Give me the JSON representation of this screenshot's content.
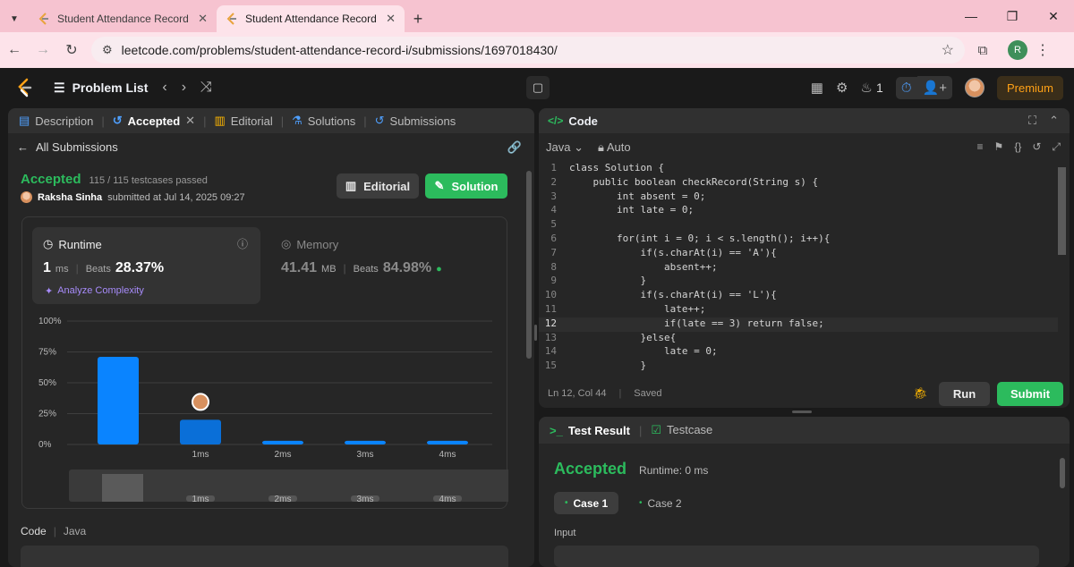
{
  "browser": {
    "tabs": [
      {
        "title": "Student Attendance Record I - Si",
        "active": false
      },
      {
        "title": "Student Attendance Record I - L",
        "active": true
      }
    ],
    "url": "leetcode.com/problems/student-attendance-record-i/submissions/1697018430/",
    "profile_initial": "R"
  },
  "nav": {
    "problem_list": "Problem List",
    "streak_count": "1",
    "premium": "Premium"
  },
  "left_panel": {
    "tabs": [
      "Description",
      "Accepted",
      "Editorial",
      "Solutions",
      "Submissions"
    ],
    "all_submissions": "All Submissions",
    "status": "Accepted",
    "testcases": "115 / 115 testcases passed",
    "submitter": "Raksha Sinha",
    "submitted_at": "submitted at Jul 14, 2025 09:27",
    "editorial_btn": "Editorial",
    "solution_btn": "Solution",
    "runtime": {
      "label": "Runtime",
      "value": "1",
      "unit": "ms",
      "beats_label": "Beats",
      "beats": "28.37%",
      "analyze": "Analyze Complexity"
    },
    "memory": {
      "label": "Memory",
      "value": "41.41",
      "unit": "MB",
      "beats_label": "Beats",
      "beats": "84.98%"
    },
    "code_label": "Code",
    "code_lang": "Java"
  },
  "chart_data": {
    "type": "bar",
    "ylabel_ticks": [
      "100%",
      "75%",
      "50%",
      "25%",
      "0%"
    ],
    "ylim": [
      0,
      100
    ],
    "categories": [
      "",
      "1ms",
      "2ms",
      "3ms",
      "4ms"
    ],
    "values": [
      71,
      20,
      3,
      3,
      3
    ],
    "highlight_index": 1,
    "overview_labels": [
      "1ms",
      "2ms",
      "3ms",
      "4ms"
    ],
    "colors": {
      "bar": "#0a84ff",
      "highlight": "#0a6fd8",
      "grid": "#3e3e3e"
    }
  },
  "editor": {
    "title": "Code",
    "language": "Java",
    "mode": "Auto",
    "lines": [
      {
        "n": "1",
        "t": "class Solution {"
      },
      {
        "n": "2",
        "t": "    public boolean checkRecord(String s) {"
      },
      {
        "n": "3",
        "t": "        int absent = 0;"
      },
      {
        "n": "4",
        "t": "        int late = 0;"
      },
      {
        "n": "5",
        "t": ""
      },
      {
        "n": "6",
        "t": "        for(int i = 0; i < s.length(); i++){"
      },
      {
        "n": "7",
        "t": "            if(s.charAt(i) == 'A'){"
      },
      {
        "n": "8",
        "t": "                absent++;"
      },
      {
        "n": "9",
        "t": "            }"
      },
      {
        "n": "10",
        "t": "            if(s.charAt(i) == 'L'){"
      },
      {
        "n": "11",
        "t": "                late++;"
      },
      {
        "n": "12",
        "t": "                if(late == 3) return false;"
      },
      {
        "n": "13",
        "t": "            }else{"
      },
      {
        "n": "14",
        "t": "                late = 0;"
      },
      {
        "n": "15",
        "t": "            }"
      }
    ],
    "current_line": "12",
    "cursor": "Ln 12, Col 44",
    "saved": "Saved",
    "run": "Run",
    "submit": "Submit"
  },
  "result": {
    "tab_result": "Test Result",
    "tab_testcase": "Testcase",
    "status": "Accepted",
    "runtime": "Runtime: 0 ms",
    "cases": [
      "Case 1",
      "Case 2"
    ],
    "input_label": "Input"
  }
}
